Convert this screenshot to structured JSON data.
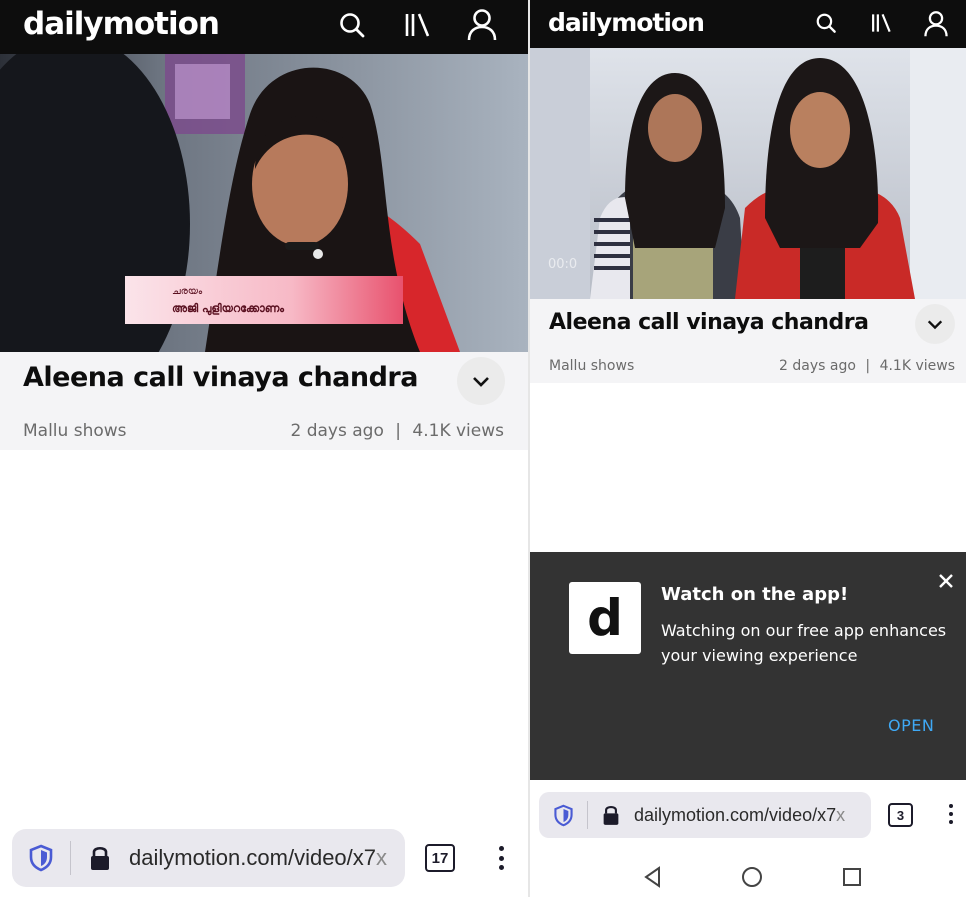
{
  "left": {
    "brand": "dailymotion",
    "video_caption_line1": "ചരയം",
    "video_caption_line2": "അജി പുളിയറക്കോണം",
    "title": "Aleena call vinaya chandra",
    "channel": "Mallu shows",
    "age": "2 days ago",
    "separator": "|",
    "views": "4.1K views",
    "url_main": "dailymotion.com/video/x7",
    "url_fade": "x",
    "tab_count": "17"
  },
  "right": {
    "brand": "dailymotion",
    "player_time": "00:0",
    "title": "Aleena call vinaya chandra",
    "channel": "Mallu shows",
    "age": "2 days ago",
    "separator": "|",
    "views": "4.1K views",
    "banner": {
      "logo_letter": "d",
      "title": "Watch on the app!",
      "text": "Watching on our free app enhances your viewing experience",
      "open_label": "OPEN"
    },
    "url_main": "dailymotion.com/video/x7",
    "url_fade": "x",
    "tab_count": "3"
  },
  "colors": {
    "topbar": "#0d0d0d",
    "banner_bg": "#333333",
    "open_link": "#3fa9f5",
    "shield": "#4a5bd4"
  },
  "icons": [
    "search-icon",
    "library-icon",
    "account-icon",
    "chevron-down-icon",
    "shield-icon",
    "lock-icon",
    "close-icon",
    "back-icon",
    "home-icon",
    "recents-icon"
  ]
}
